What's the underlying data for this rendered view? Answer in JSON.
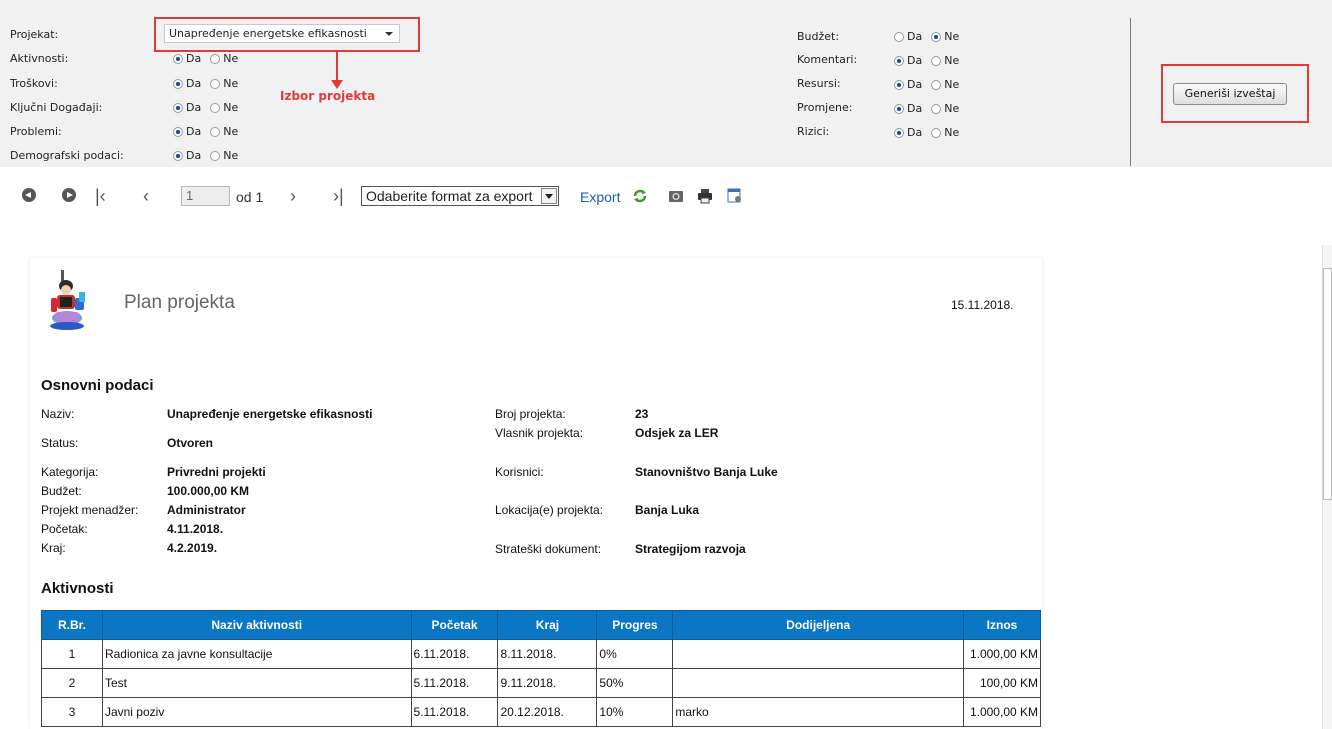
{
  "filters": {
    "left": [
      {
        "label": "Projekat:"
      },
      {
        "label": "Aktivnosti:",
        "selected": "Da"
      },
      {
        "label": "Troškovi:",
        "selected": "Da"
      },
      {
        "label": "Ključni Događaji:",
        "selected": "Da"
      },
      {
        "label": "Problemi:",
        "selected": "Da"
      },
      {
        "label": "Demografski podaci:",
        "selected": "Da"
      }
    ],
    "right": [
      {
        "label": "Budžet:",
        "selected": "Ne"
      },
      {
        "label": "Komentari:",
        "selected": "Da"
      },
      {
        "label": "Resursi:",
        "selected": "Da"
      },
      {
        "label": "Promjene:",
        "selected": "Da"
      },
      {
        "label": "Rizici:",
        "selected": "Da"
      }
    ],
    "option_yes": "Da",
    "option_no": "Ne",
    "project_select_value": "Unapređenje energetske efikasnosti",
    "annotation": "Izbor projekta",
    "generate_button": "Generiši izveštaj"
  },
  "toolbar": {
    "page_value": "1",
    "page_of": "od 1",
    "export_select": "Odaberite format za export",
    "export_link": "Export"
  },
  "report": {
    "title": "Plan projekta",
    "date": "15.11.2018.",
    "section_basic": "Osnovni podaci",
    "basic_left": [
      {
        "label": "Naziv:",
        "value": "Unapređenje energetske efikasnosti"
      },
      {
        "label": "Status:",
        "value": "Otvoren"
      },
      {
        "label": "Kategorija:",
        "value": "Privredni projekti"
      },
      {
        "label": "Budžet:",
        "value": "100.000,00 KM"
      },
      {
        "label": "Projekt menadžer:",
        "value": "Administrator"
      },
      {
        "label": "Početak:",
        "value": "4.11.2018."
      },
      {
        "label": "Kraj:",
        "value": "4.2.2019."
      }
    ],
    "basic_right": [
      {
        "label": "Broj projekta:",
        "value": "23"
      },
      {
        "label": "Vlasnik projekta:",
        "value": "Odsjek za LER"
      },
      {
        "label": "Korisnici:",
        "value": "Stanovništvo Banja Luke"
      },
      {
        "label": "Lokacija(e) projekta:",
        "value": "Banja Luka"
      },
      {
        "label": "Strateški dokument:",
        "value": "Strategijom razvoja"
      }
    ],
    "section_activities": "Aktivnosti",
    "table_headers": [
      "R.Br.",
      "Naziv aktivnosti",
      "Početak",
      "Kraj",
      "Progres",
      "Dodijeljena",
      "Iznos"
    ],
    "rows": [
      [
        "1",
        "Radionica za javne konsultacije",
        "6.11.2018.",
        "8.11.2018.",
        "0%",
        "",
        "1.000,00 KM"
      ],
      [
        "2",
        "Test",
        "5.11.2018.",
        "9.11.2018.",
        "50%",
        "",
        "100,00 KM"
      ],
      [
        "3",
        "Javni poziv",
        "5.11.2018.",
        "20.12.2018.",
        "10%",
        "marko",
        "1.000,00 KM"
      ]
    ]
  },
  "colors": {
    "accent_red": "#e03b3b",
    "table_header": "#0a76c4",
    "link": "#1a5fb4"
  }
}
